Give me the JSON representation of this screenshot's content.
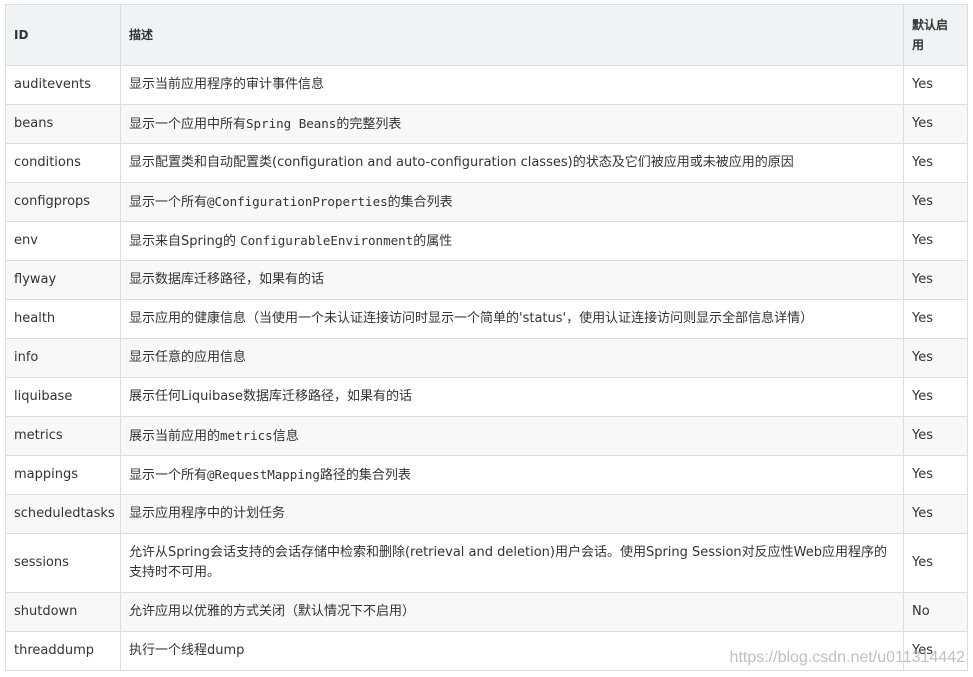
{
  "table": {
    "headers": {
      "id": "ID",
      "desc": "描述",
      "default": "默认启用"
    },
    "rows": [
      {
        "id": "auditevents",
        "desc": [
          {
            "t": "显示当前应用程序的审计事件信息"
          }
        ],
        "default": "Yes"
      },
      {
        "id": "beans",
        "desc": [
          {
            "t": "显示一个应用中所有"
          },
          {
            "t": "Spring Beans",
            "mono": true
          },
          {
            "t": "的完整列表"
          }
        ],
        "default": "Yes"
      },
      {
        "id": "conditions",
        "desc": [
          {
            "t": "显示配置类和自动配置类(configuration and auto-configuration classes)的状态及它们被应用或未被应用的原因"
          }
        ],
        "default": "Yes"
      },
      {
        "id": "configprops",
        "desc": [
          {
            "t": "显示一个所有"
          },
          {
            "t": "@ConfigurationProperties",
            "mono": true
          },
          {
            "t": "的集合列表"
          }
        ],
        "default": "Yes"
      },
      {
        "id": "env",
        "desc": [
          {
            "t": "显示来自Spring的 "
          },
          {
            "t": "ConfigurableEnvironment",
            "mono": true
          },
          {
            "t": "的属性"
          }
        ],
        "default": "Yes"
      },
      {
        "id": "flyway",
        "desc": [
          {
            "t": "显示数据库迁移路径，如果有的话"
          }
        ],
        "default": "Yes"
      },
      {
        "id": "health",
        "desc": [
          {
            "t": "显示应用的健康信息（当使用一个未认证连接访问时显示一个简单的'status'，使用认证连接访问则显示全部信息详情）"
          }
        ],
        "default": "Yes"
      },
      {
        "id": "info",
        "desc": [
          {
            "t": "显示任意的应用信息"
          }
        ],
        "default": "Yes"
      },
      {
        "id": "liquibase",
        "desc": [
          {
            "t": "展示任何Liquibase数据库迁移路径，如果有的话"
          }
        ],
        "default": "Yes"
      },
      {
        "id": "metrics",
        "desc": [
          {
            "t": "展示当前应用的"
          },
          {
            "t": "metrics",
            "mono": true
          },
          {
            "t": "信息"
          }
        ],
        "default": "Yes"
      },
      {
        "id": "mappings",
        "desc": [
          {
            "t": "显示一个所有"
          },
          {
            "t": "@RequestMapping",
            "mono": true
          },
          {
            "t": "路径的集合列表"
          }
        ],
        "default": "Yes"
      },
      {
        "id": "scheduledtasks",
        "desc": [
          {
            "t": "显示应用程序中的计划任务"
          }
        ],
        "default": "Yes"
      },
      {
        "id": "sessions",
        "desc": [
          {
            "t": "允许从Spring会话支持的会话存储中检索和删除(retrieval and deletion)用户会话。使用Spring Session对反应性Web应用程序的支持时不可用。"
          }
        ],
        "default": "Yes"
      },
      {
        "id": "shutdown",
        "desc": [
          {
            "t": "允许应用以优雅的方式关闭（默认情况下不启用）"
          }
        ],
        "default": "No"
      },
      {
        "id": "threaddump",
        "desc": [
          {
            "t": "执行一个线程dump"
          }
        ],
        "default": "Yes"
      }
    ]
  },
  "watermark": "https://blog.csdn.net/u011314442",
  "colors": {
    "header_bg": "#eff3f5",
    "alt_row_bg": "#f7f8f9",
    "border": "#dddddd",
    "text": "#333333"
  }
}
